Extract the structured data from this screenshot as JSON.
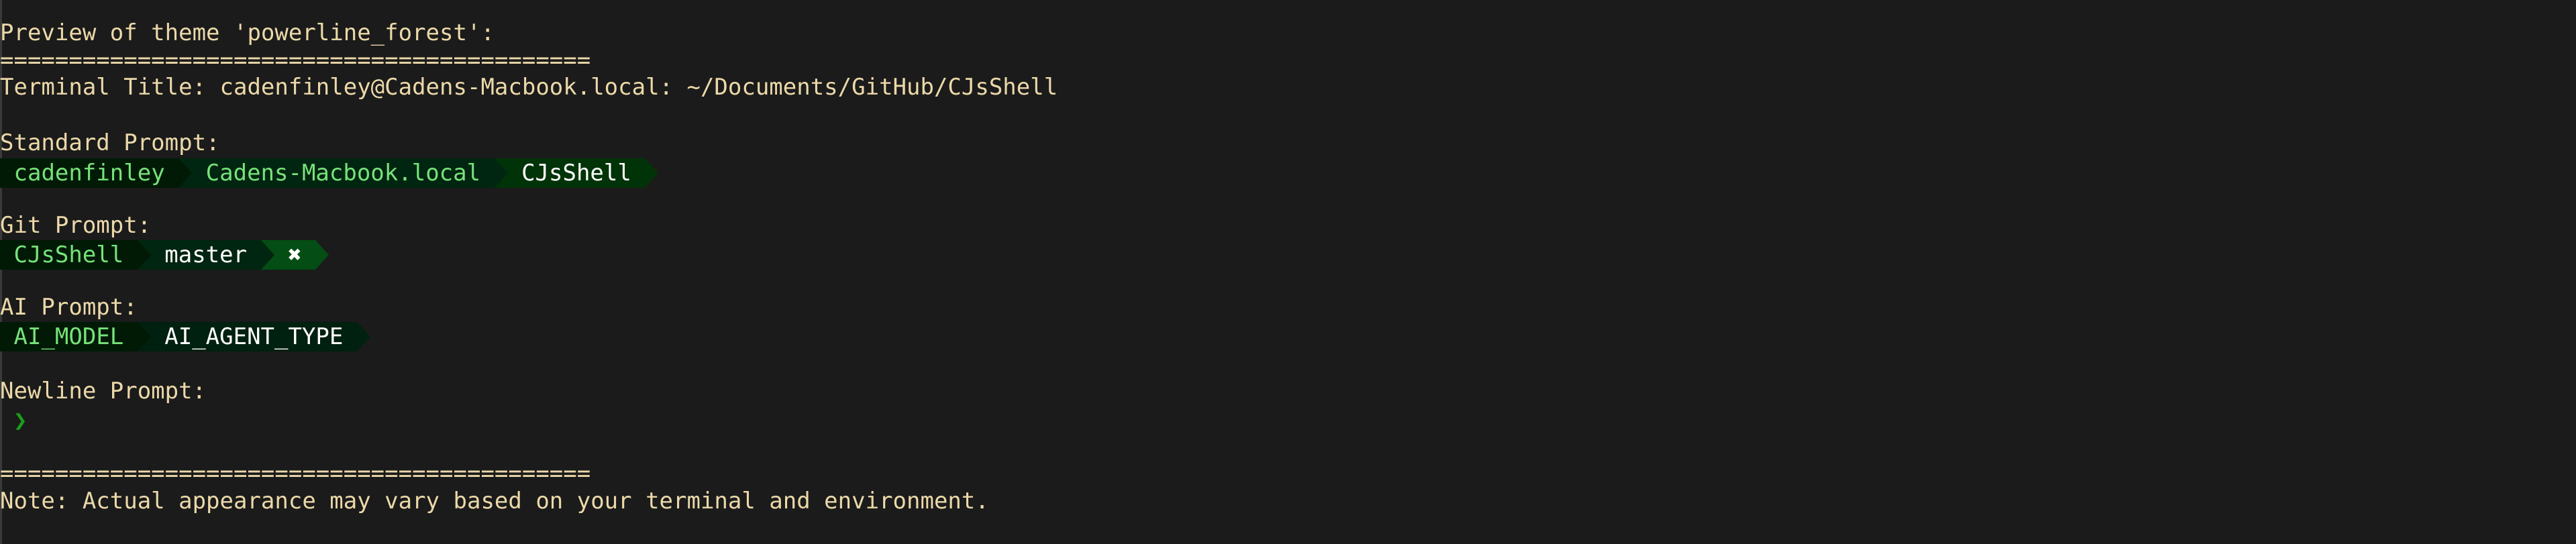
{
  "heading": "Preview of theme 'powerline_forest':",
  "separator": "===========================================",
  "terminal_title": "Terminal Title: cadenfinley@Cadens-Macbook.local: ~/Documents/GitHub/CJsShell",
  "colors": {
    "background": "#1b1b1b",
    "label": "#ecd9a9",
    "green_text": "#77e27a",
    "white_text": "#ffffff",
    "newline_arrow": "#1a9e1a"
  },
  "sections": [
    {
      "label": "Standard Prompt:",
      "segments": [
        {
          "text": "cadenfinley",
          "fg": "#77e27a",
          "bg": "#001a06"
        },
        {
          "text": "Cadens-Macbook.local",
          "fg": "#77e27a",
          "bg": "#002510"
        },
        {
          "text": "CJsShell",
          "fg": "#ffffff",
          "bg": "#003308"
        }
      ]
    },
    {
      "label": "Git Prompt:",
      "segments": [
        {
          "text": "CJsShell",
          "fg": "#77e27a",
          "bg": "#001a06"
        },
        {
          "text": "master",
          "fg": "#ffffff",
          "bg": "#002510"
        },
        {
          "text": "✖",
          "fg": "#ffffff",
          "bg": "#044d14"
        }
      ]
    },
    {
      "label": "AI Prompt:",
      "segments": [
        {
          "text": "AI_MODEL",
          "fg": "#77e27a",
          "bg": "#001a06"
        },
        {
          "text": "AI_AGENT_TYPE",
          "fg": "#ffffff",
          "bg": "#002010"
        }
      ]
    }
  ],
  "newline": {
    "label": "Newline Prompt:",
    "symbol": "❯"
  },
  "note": "Note: Actual appearance may vary based on your terminal and environment."
}
